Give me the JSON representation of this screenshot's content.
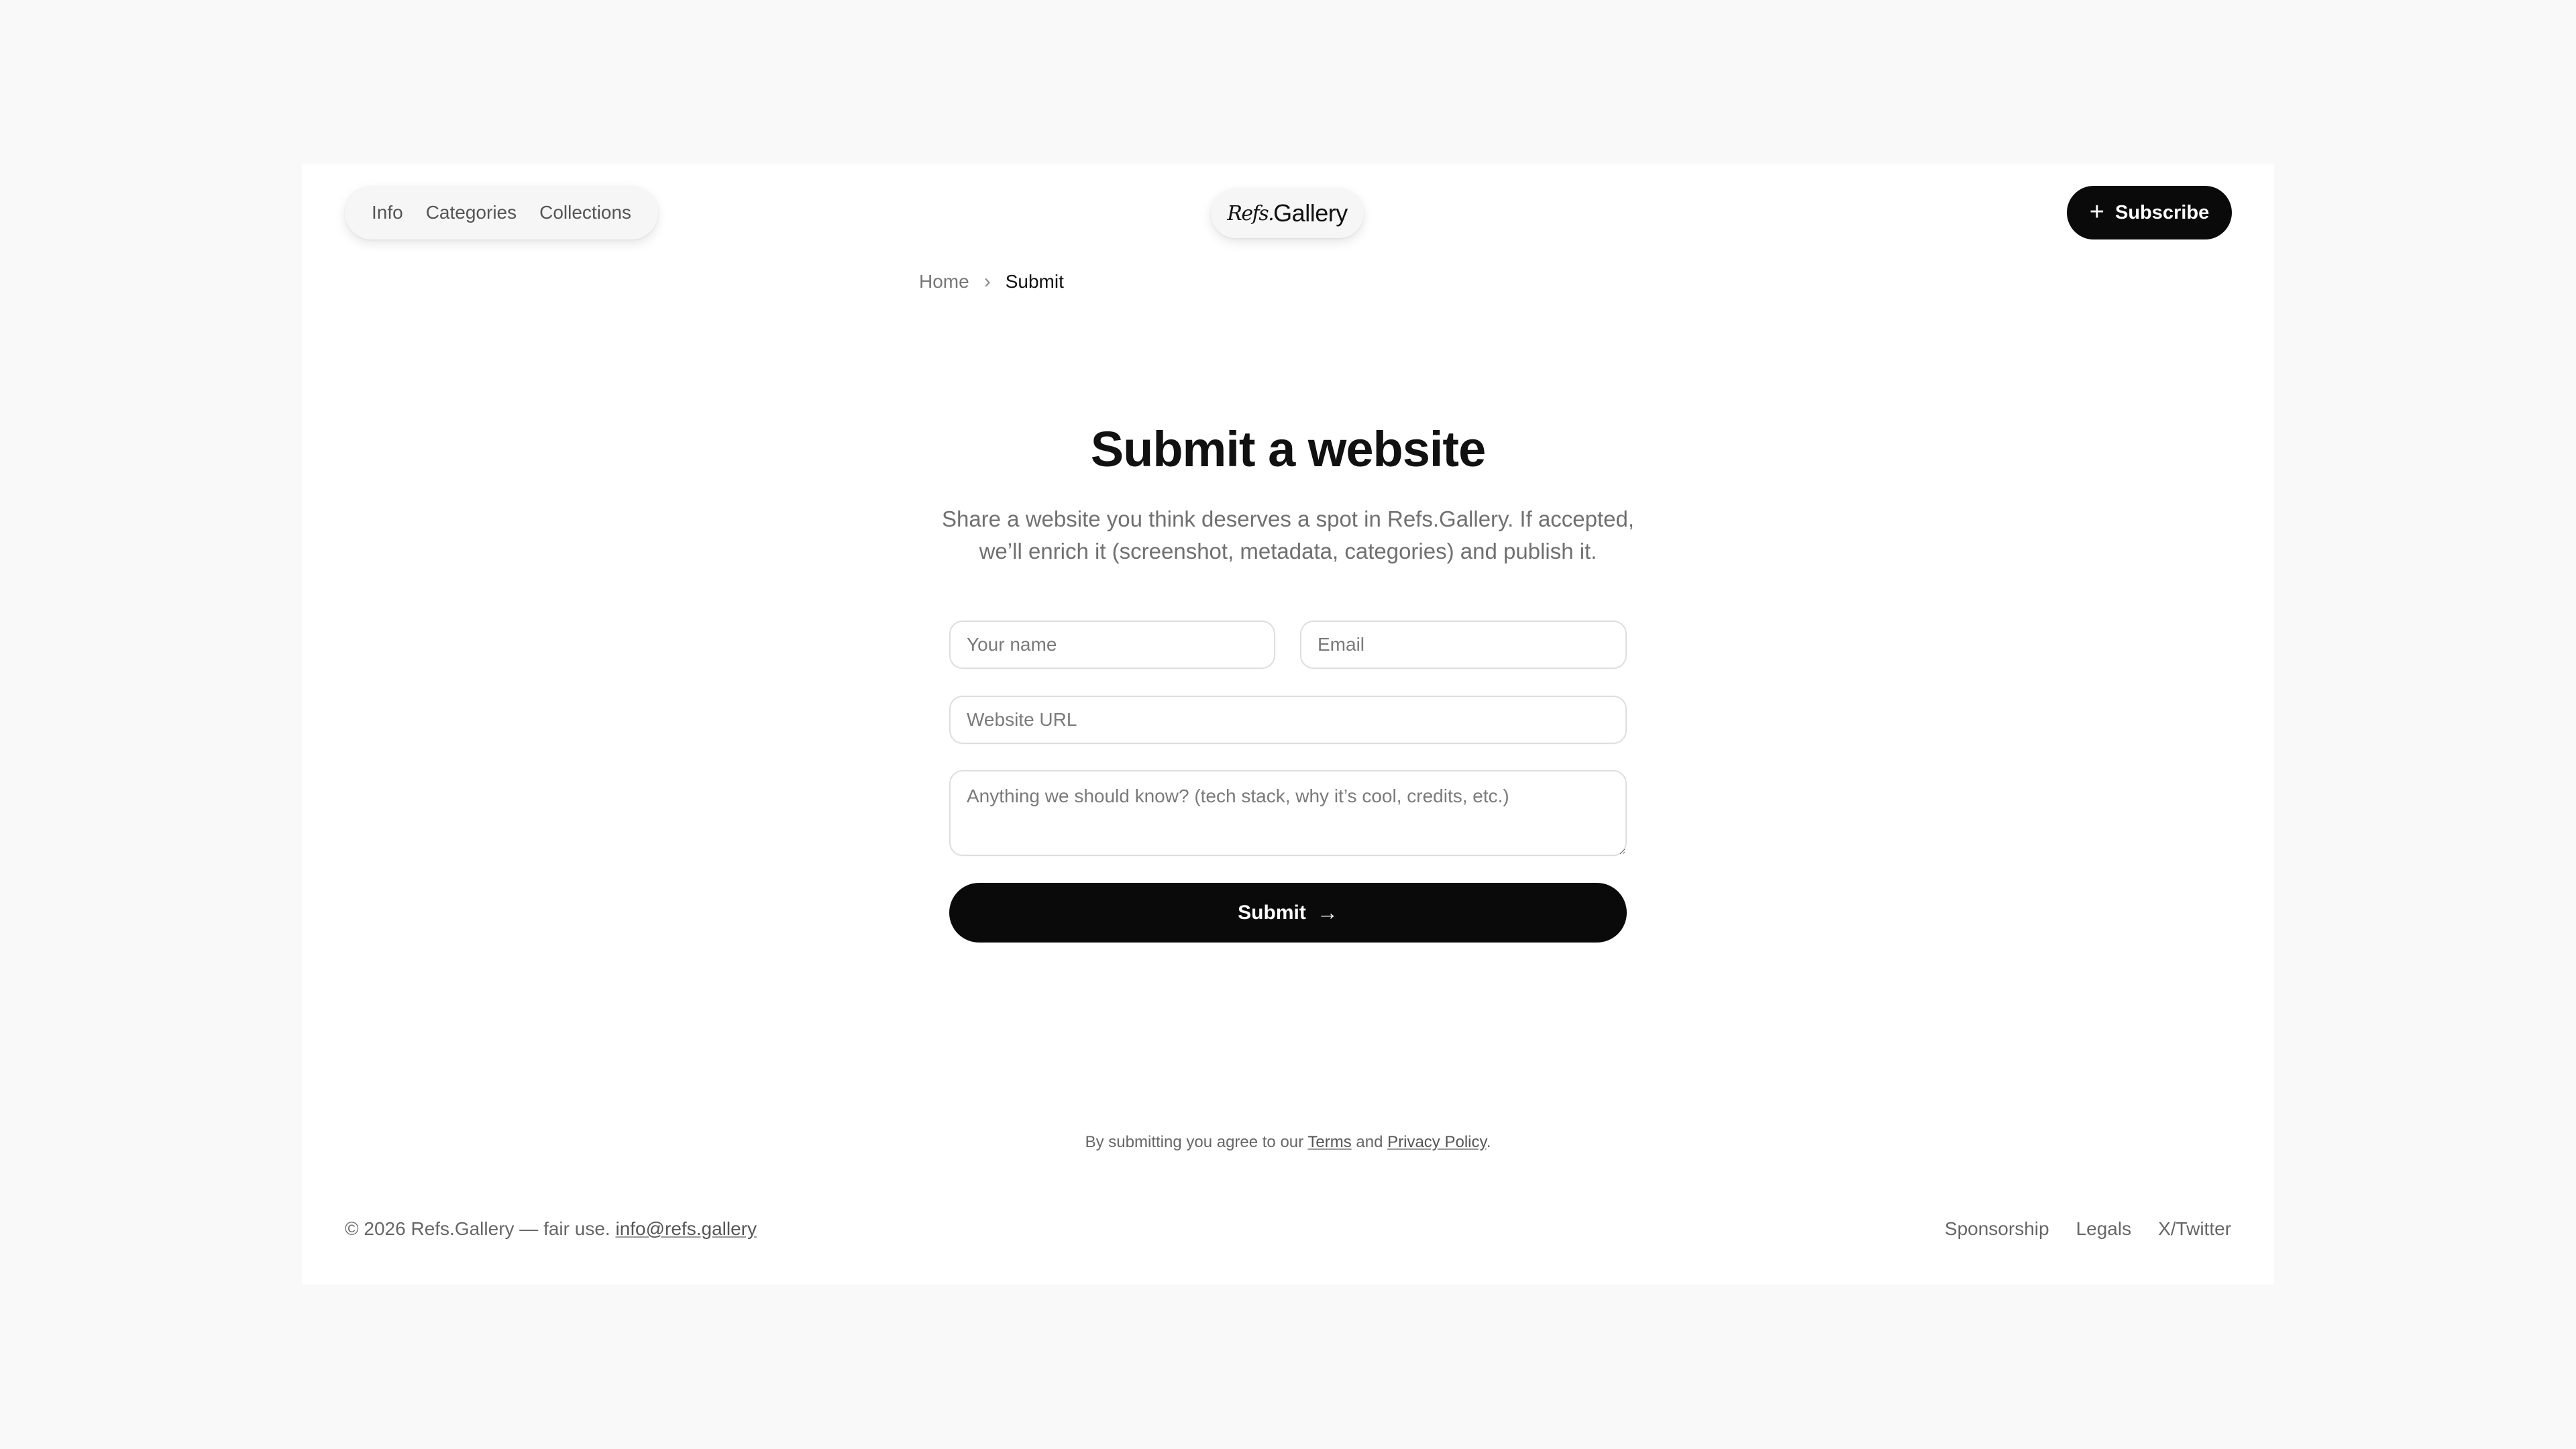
{
  "header": {
    "nav": [
      {
        "label": "Info"
      },
      {
        "label": "Categories"
      },
      {
        "label": "Collections"
      }
    ],
    "logo": {
      "script": "Refs.",
      "text": "Gallery"
    },
    "subscribe": {
      "icon": "plus-icon",
      "label": "Subscribe"
    }
  },
  "breadcrumb": {
    "home": "Home",
    "separator_icon": "chevron-right-icon",
    "current": "Submit"
  },
  "main": {
    "title": "Submit a website",
    "subtitle": "Share a website you think deserves a spot in Refs.Gallery. If accepted, we’ll enrich it (screenshot, metadata, categories) and publish it.",
    "form": {
      "name_placeholder": "Your name",
      "email_placeholder": "Email",
      "url_placeholder": "Website URL",
      "notes_placeholder": "Anything we should know? (tech stack, why it’s cool, credits, etc.)",
      "submit_label": "Submit",
      "submit_icon": "arrow-right-icon"
    },
    "legal": {
      "prefix": "By submitting you agree to our ",
      "terms": "Terms",
      "and": " and ",
      "privacy": "Privacy Policy",
      "suffix": "."
    }
  },
  "footer": {
    "copyright": "© 2026 Refs.Gallery — fair use.",
    "email": "info@refs.gallery",
    "links": [
      {
        "label": "Sponsorship"
      },
      {
        "label": "Legals"
      },
      {
        "label": "X/Twitter"
      }
    ]
  },
  "colors": {
    "page_background": "#f9f9f9",
    "panel_background": "#ffffff",
    "primary_button": "#0a0a0a",
    "muted_text": "#707070"
  }
}
